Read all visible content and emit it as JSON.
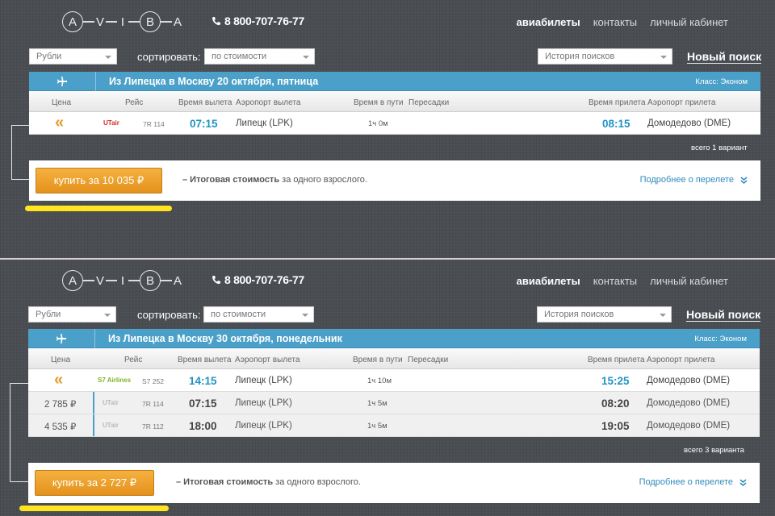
{
  "screens": [
    {
      "logo_letters": [
        "A",
        "V",
        "I",
        "B",
        "A"
      ],
      "phone": "8 800-707-76-77",
      "nav": [
        "авиабилеты",
        "контакты",
        "личный кабинет"
      ],
      "currency": "Рубли",
      "sort_label": "сортировать:",
      "sort_value": "по стоимости",
      "history": "История поисков",
      "new_search": "Новый поиск",
      "route_title": "Из Липецка в Москву 20 октября, пятница",
      "class_label": "Класс: Эконом",
      "headers": {
        "price": "Цена",
        "flight": "Рейс",
        "dep_time": "Время вылета",
        "dep_airport": "Аэропорт вылета",
        "duration": "Время в пути",
        "transfers": "Пересадки",
        "arr_time": "Время прилета",
        "arr_airport": "Аэропорт прилета"
      },
      "flights": [
        {
          "price": "",
          "airline": "UTair",
          "flight_no": "7R 114",
          "dep": "07:15",
          "dep_airport": "Липецк (LPK)",
          "duration": "1ч 0м",
          "arr": "08:15",
          "arr_airport": "Домодедово (DME)"
        }
      ],
      "variants": "всего 1 вариант",
      "buy": "купить за 10 035 ₽",
      "total_bold": "– Итоговая стоимость",
      "total_rest": " за одного взрослого.",
      "details": "Подробнее о перелете",
      "accent": "#4aa0c8",
      "button_color": "#eda02d",
      "highlight_color": "#ffe51f"
    },
    {
      "logo_letters": [
        "A",
        "V",
        "I",
        "B",
        "A"
      ],
      "phone": "8 800-707-76-77",
      "nav": [
        "авиабилеты",
        "контакты",
        "личный кабинет"
      ],
      "currency": "Рубли",
      "sort_label": "сортировать:",
      "sort_value": "по стоимости",
      "history": "История поисков",
      "new_search": "Новый поиск",
      "route_title": "Из Липецка в Москву 30 октября, понедельник",
      "class_label": "Класс: Эконом",
      "headers": {
        "price": "Цена",
        "flight": "Рейс",
        "dep_time": "Время вылета",
        "dep_airport": "Аэропорт вылета",
        "duration": "Время в пути",
        "transfers": "Пересадки",
        "arr_time": "Время прилета",
        "arr_airport": "Аэропорт прилета"
      },
      "flights": [
        {
          "price": "",
          "airline": "S7 Airlines",
          "flight_no": "S7 252",
          "dep": "14:15",
          "dep_airport": "Липецк (LPK)",
          "duration": "1ч 10м",
          "arr": "15:25",
          "arr_airport": "Домодедово (DME)"
        },
        {
          "price": "2 785 ₽",
          "airline": "UTair",
          "flight_no": "7R 114",
          "dep": "07:15",
          "dep_airport": "Липецк (LPK)",
          "duration": "1ч 5м",
          "arr": "08:20",
          "arr_airport": "Домодедово (DME)"
        },
        {
          "price": "4 535 ₽",
          "airline": "UTair",
          "flight_no": "7R 112",
          "dep": "18:00",
          "dep_airport": "Липецк (LPK)",
          "duration": "1ч 5м",
          "arr": "19:05",
          "arr_airport": "Домодедово (DME)"
        }
      ],
      "variants": "всего 3 варианта",
      "buy": "купить за 2 727 ₽",
      "total_bold": "– Итоговая стоимость",
      "total_rest": " за одного взрослого.",
      "details": "Подробнее о перелете"
    }
  ]
}
